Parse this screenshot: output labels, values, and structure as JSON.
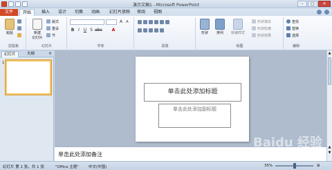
{
  "window": {
    "title": "演示文稿1 - Microsoft PowerPoint",
    "minimize": "–",
    "maximize": "□",
    "close": "✕"
  },
  "tabs": [
    "文件",
    "开始",
    "插入",
    "设计",
    "切换",
    "动画",
    "幻灯片放映",
    "审阅",
    "视图"
  ],
  "ribbon": {
    "clipboard": {
      "paste": "粘贴",
      "label": "剪贴板"
    },
    "slides": {
      "new_slide": "新建\n幻灯片",
      "layout": "版式",
      "reset": "重设",
      "section": "节",
      "label": "幻灯片"
    },
    "font": {
      "label": "字体",
      "size_a_up": "A",
      "size_a_down": "A"
    },
    "paragraph": {
      "label": "段落"
    },
    "drawing": {
      "shapes": "形状",
      "arrange": "排列",
      "quick_styles": "快速样式",
      "fill": "形状填充",
      "outline": "形状轮廓",
      "effects": "形状效果",
      "label": "绘图"
    },
    "editing": {
      "find": "查找",
      "replace": "替换",
      "select": "选择",
      "label": "编辑"
    }
  },
  "panel": {
    "tab_slides": "幻灯片",
    "tab_outline": "大纲",
    "close": "×",
    "thumb_number": "1"
  },
  "slide": {
    "title_placeholder": "单击此处添加标题",
    "subtitle_placeholder": "单击此处添加副标题"
  },
  "notes": {
    "placeholder": "单击此处添加备注"
  },
  "status": {
    "slide_pos": "幻灯片 第 1 张，共 1 张",
    "theme": "\"Office 主题\"",
    "language": "中文(中国)",
    "zoom": "35%"
  },
  "watermark": "Baidu 经验",
  "colors": {
    "file_tab": "#d24726",
    "ribbon_bg": "#e8eef7",
    "canvas_bg": "#aebccd",
    "thumb_highlight": "#f3c66a"
  }
}
